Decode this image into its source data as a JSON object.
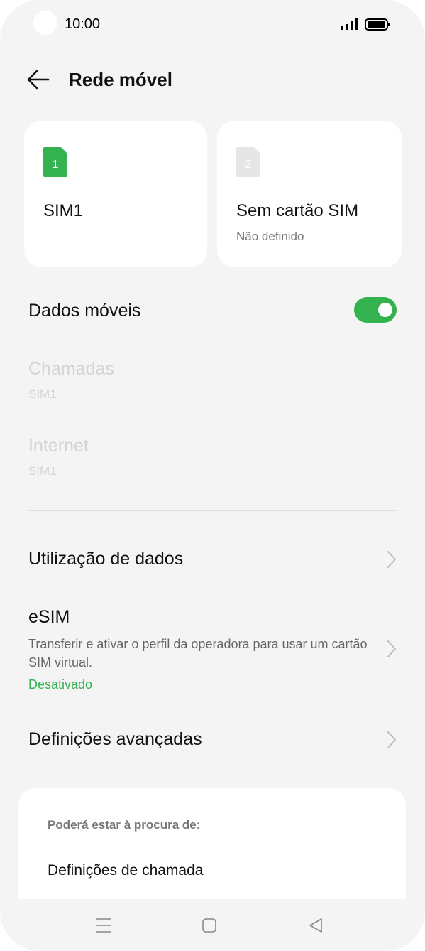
{
  "status_bar": {
    "time": "10:00",
    "signal_icon": "signal-bars-icon",
    "battery_icon": "battery-full-icon"
  },
  "header": {
    "title": "Rede móvel",
    "back_icon": "arrow-left-icon"
  },
  "sim_cards": [
    {
      "number": "1",
      "name": "SIM1",
      "subtitle": "",
      "color": "#33b24f"
    },
    {
      "number": "2",
      "name": "Sem cartão SIM",
      "subtitle": "Não definido",
      "color": "#e6e6e6"
    }
  ],
  "mobile_data": {
    "label": "Dados móveis",
    "enabled": true,
    "toggle_color": "#33b24f"
  },
  "calls": {
    "label": "Chamadas",
    "value": "SIM1"
  },
  "internet": {
    "label": "Internet",
    "value": "SIM1"
  },
  "data_usage": {
    "label": "Utilização de dados"
  },
  "esim": {
    "label": "eSIM",
    "description": "Transferir e ativar o perfil da operadora para usar um cartão SIM virtual.",
    "status": "Desativado",
    "status_color": "#33b24f"
  },
  "advanced": {
    "label": "Definições avançadas"
  },
  "suggestions": {
    "title": "Poderá estar à procura de:",
    "items": [
      "Definições de chamada"
    ]
  },
  "bottom_nav": {
    "menu_icon": "menu-icon",
    "home_icon": "home-square-icon",
    "back_icon": "back-triangle-icon"
  }
}
